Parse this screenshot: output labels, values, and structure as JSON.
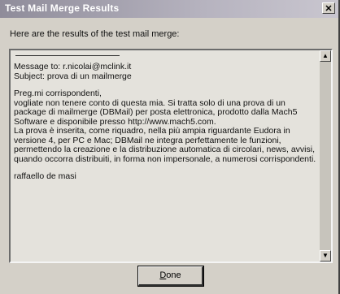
{
  "window": {
    "title": "Test Mail Merge Results",
    "close_glyph": "✕"
  },
  "intro": "Here are the results of the test mail merge:",
  "message": {
    "to_line": "Message to: r.nicolai@mclink.it",
    "subject_line": "Subject: prova di un mailmerge",
    "body_paragraphs": [
      "Preg.mi corrispondenti,\nvogliate non tenere conto di questa mia. Si tratta solo di una prova di un package di mailmerge (DBMail) per posta elettronica, prodotto dalla Mach5 Software e disponibile presso http://www.mach5.com.\nLa prova è inserita, come riquadro, nella più ampia riguardante Eudora in versione 4, per PC e Mac; DBMail ne integra perfettamente le funzioni, permettendo la creazione e la distribuzione automatica di circolari, news, avvisi, quando occorra distribuiti, in forma non impersonale, a numerosi corrispondenti.",
      "raffaello de masi"
    ]
  },
  "scrollbar": {
    "up_icon": "arrow-up-icon",
    "down_icon": "arrow-down-icon"
  },
  "done_button": {
    "mnemonic": "D",
    "rest": "one"
  }
}
